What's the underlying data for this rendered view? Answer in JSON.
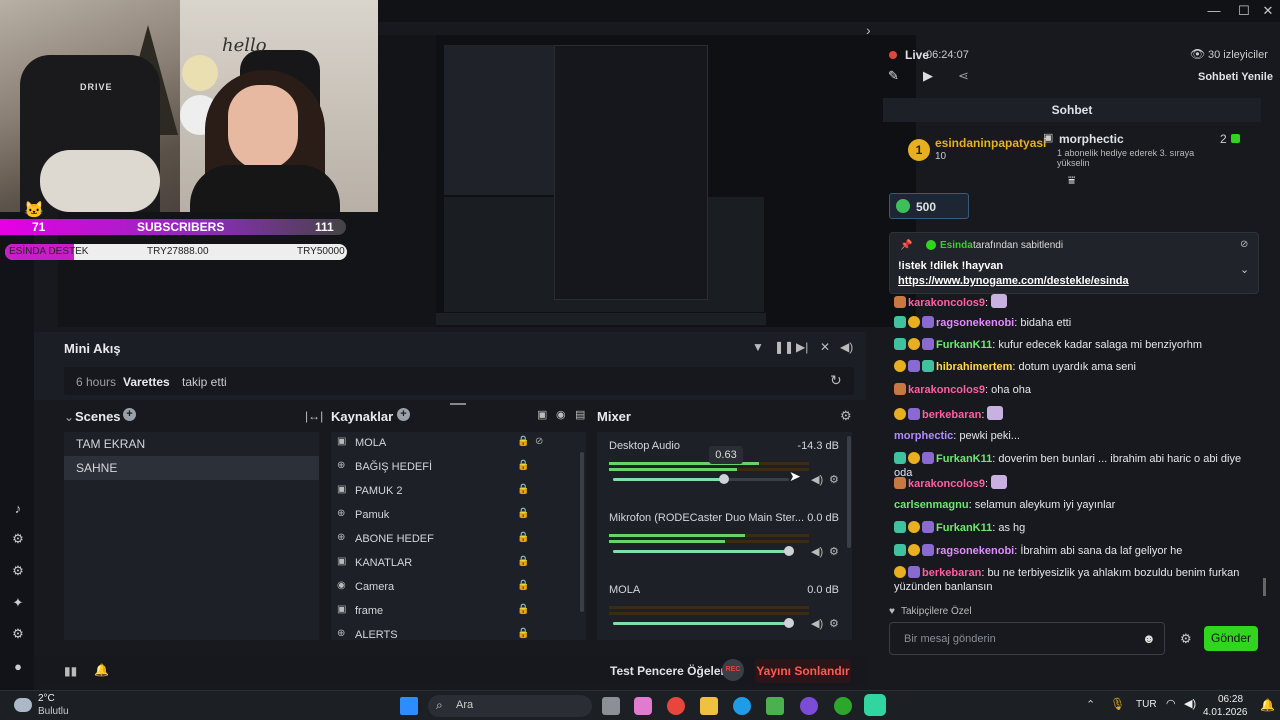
{
  "titlebar": {
    "min": "—",
    "max": "☐",
    "close": "✕"
  },
  "overlay": {
    "sub_count": "71",
    "sub_label": "SUBSCRIBERS",
    "sub_target": "111",
    "destek_label": "ESİNDA DESTEK",
    "destek_current": "TRY27888.00",
    "destek_goal": "TRY50000",
    "destek_progress": 0.56,
    "cam_text": "hello",
    "chair_text": "DRIVE"
  },
  "mini_akis": {
    "title": "Mini Akış",
    "time": "6 hours",
    "user": "Varettes",
    "action": "takip etti"
  },
  "scenes": {
    "title": "Scenes",
    "items": [
      "TAM EKRAN",
      "SAHNE"
    ],
    "selected": 1
  },
  "sources": {
    "title": "Kaynaklar",
    "items": [
      {
        "name": "MOLA",
        "icon": "image-icon"
      },
      {
        "name": "BAĞIŞ HEDEFİ",
        "icon": "globe-icon"
      },
      {
        "name": "PAMUK 2",
        "icon": "image-icon"
      },
      {
        "name": "Pamuk",
        "icon": "globe-icon"
      },
      {
        "name": "ABONE HEDEF",
        "icon": "globe-icon"
      },
      {
        "name": "KANATLAR",
        "icon": "image-icon"
      },
      {
        "name": "Camera",
        "icon": "camera-icon"
      },
      {
        "name": "frame",
        "icon": "image-icon"
      },
      {
        "name": "ALERTS",
        "icon": "globe-icon"
      }
    ]
  },
  "mixer": {
    "title": "Mixer",
    "channels": [
      {
        "name": "Desktop Audio",
        "db": "-14.3 dB",
        "level": 0.63,
        "tooltip": "0.63",
        "meter": 0.75
      },
      {
        "name": "Mikrofon (RODECaster Duo Main Ster...",
        "db": "0.0 dB",
        "level": 1.0,
        "meter": 0.68
      },
      {
        "name": "MOLA",
        "db": "0.0 dB",
        "level": 1.0,
        "meter": 0
      }
    ]
  },
  "bottom": {
    "test_label": "Test Pencere Öğeleri",
    "rec": "REC",
    "end_label": "Yayını Sonlandır"
  },
  "chat": {
    "live_label": "Live",
    "live_time": "06:24:07",
    "viewers": "30 izleyiciler",
    "refresh": "Sohbeti Yenile",
    "header": "Sohbet",
    "top_user": "esindaninpapatyasi",
    "top_count": "10",
    "top_rank": "1",
    "gift_user": "morphectic",
    "gift_text": "1 abonelik hediye ederek 3. sıraya yükselin",
    "gift_count": "2",
    "points": "500",
    "pinned_by": "Esinda",
    "pinned_suffix": "tarafından sabitlendi",
    "pinned_line1": "!istek !dilek !hayvan",
    "pinned_link": "https://www.bynogame.com/destekle/esinda",
    "messages": [
      {
        "user": "karakoncolos9",
        "text": "",
        "color": "#ff5fa2",
        "badges": [
          "b-c"
        ]
      },
      {
        "user": "ragsonekenobi",
        "text": "bidaha etti",
        "color": "#e38bff",
        "badges": [
          "b-g",
          "b-y",
          "b-p"
        ]
      },
      {
        "user": "FurkanK11",
        "text": "kufur edecek kadar salaga mi benziyorhm",
        "color": "#6ee86e",
        "badges": [
          "b-g",
          "b-y",
          "b-p"
        ]
      },
      {
        "user": "hibrahimertem",
        "text": "dotum uyardık ama seni",
        "color": "#ffd84a",
        "badges": [
          "b-y",
          "b-p",
          "b-g"
        ]
      },
      {
        "user": "karakoncolos9",
        "text": "oha oha",
        "color": "#ff5fa2",
        "badges": [
          "b-c"
        ]
      },
      {
        "user": "berkebaran",
        "text": "",
        "color": "#ff5fa2",
        "badges": [
          "b-y",
          "b-p"
        ]
      },
      {
        "user": "morphectic",
        "text": "pewki peki...",
        "color": "#b28cff",
        "badges": []
      },
      {
        "user": "FurkanK11",
        "text": "doverim ben bunlari ... ibrahim abi haric o abi diye oda",
        "color": "#6ee86e",
        "badges": [
          "b-g",
          "b-y",
          "b-p"
        ]
      },
      {
        "user": "karakoncolos9",
        "text": "",
        "color": "#ff5fa2",
        "badges": [
          "b-c"
        ]
      },
      {
        "user": "carlsenmagnu",
        "text": "selamun aleykum iyi yayınlar",
        "color": "#6ee86e",
        "badges": []
      },
      {
        "user": "FurkanK11",
        "text": "as hg",
        "color": "#6ee86e",
        "badges": [
          "b-g",
          "b-y",
          "b-p"
        ]
      },
      {
        "user": "ragsonekenobi",
        "text": "İbrahim abi sana da laf geliyor he",
        "color": "#e38bff",
        "badges": [
          "b-g",
          "b-y",
          "b-p"
        ]
      },
      {
        "user": "berkebaran",
        "text": "bu ne terbiyesizlik ya ahlakım bozuldu benim furkan yüzünden banlansın",
        "color": "#ff5fa2",
        "badges": [
          "b-y",
          "b-p"
        ]
      }
    ],
    "followers_only": "Takipçilere Özel",
    "input_placeholder": "Bir mesaj gönderin",
    "send": "Gönder"
  },
  "taskbar": {
    "weather_temp": "2°C",
    "weather_desc": "Bulutlu",
    "search": "Ara",
    "lang": "TUR",
    "time": "06:28",
    "date": "4.01.2026"
  }
}
